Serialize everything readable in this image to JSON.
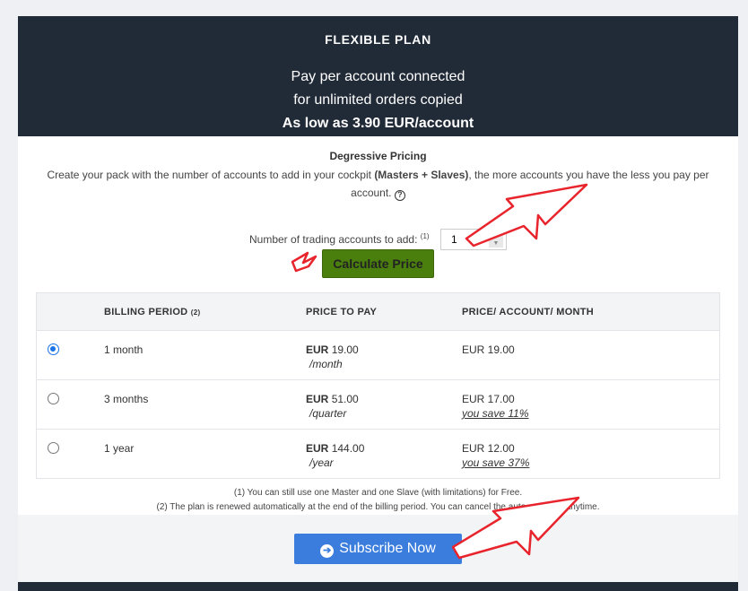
{
  "hero": {
    "title": "FLEXIBLE PLAN",
    "line1": "Pay per account connected",
    "line2": "for unlimited orders copied",
    "line3": "As low as 3.90 EUR/account"
  },
  "pricing": {
    "title": "Degressive Pricing",
    "desc_pre": "Create your pack with the number of accounts to add in your cockpit ",
    "desc_bold": "(Masters + Slaves)",
    "desc_post": ", the more accounts you have the less you pay per account.",
    "help_icon": "question-circle-icon"
  },
  "accounts": {
    "label": "Number of trading accounts to add:",
    "label_sup": "(1)",
    "value": "1",
    "spinner_up": "▲",
    "spinner_down": "▼"
  },
  "calc_label": "Calculate Price",
  "table": {
    "headers": {
      "period": "BILLING PERIOD",
      "period_sup": "(2)",
      "price": "PRICE TO PAY",
      "per_month": "PRICE/ ACCOUNT/ MONTH"
    },
    "rows": [
      {
        "period": "1 month",
        "cur": "EUR",
        "price": "19.00",
        "per": "/month",
        "monthly": "EUR 19.00",
        "save": "",
        "checked": true
      },
      {
        "period": "3 months",
        "cur": "EUR",
        "price": "51.00",
        "per": "/quarter",
        "monthly": "EUR 17.00",
        "save": "you save 11%",
        "checked": false
      },
      {
        "period": "1 year",
        "cur": "EUR",
        "price": "144.00",
        "per": "/year",
        "monthly": "EUR 12.00",
        "save": "you save 37%",
        "checked": false
      }
    ]
  },
  "notes": {
    "n1": "(1) You can still use one Master and one Slave (with limitations) for Free.",
    "n2": "(2) The plan is renewed automatically at the end of the billing period. You can cancel the auto-renew at anytime."
  },
  "subscribe": {
    "label": "Subscribe Now",
    "icon": "arrow-circle-right-icon",
    "glyph": "➔"
  },
  "colors": {
    "hero_bg": "#212a37",
    "calc_bg": "#4a7f0e",
    "subscribe_bg": "#3b7ddd",
    "annotation": "#e8242c"
  }
}
